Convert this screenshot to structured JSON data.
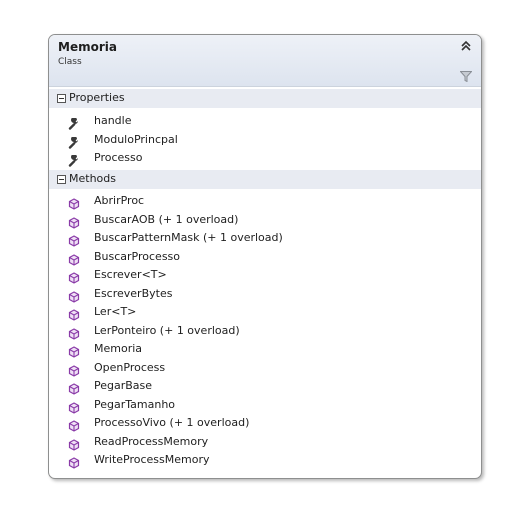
{
  "class_shape": {
    "name": "Memoria",
    "kind": "Class",
    "icons": {
      "collapse": "double-chevron-up-icon",
      "filter": "filter-icon"
    }
  },
  "sections": {
    "properties": {
      "label": "Properties",
      "icon": "wrench-icon",
      "items": [
        "handle",
        "ModuloPrincpal",
        "Processo"
      ]
    },
    "methods": {
      "label": "Methods",
      "icon": "method-cube-icon",
      "items": [
        "AbrirProc",
        "BuscarAOB (+ 1 overload)",
        "BuscarPatternMask (+ 1 overload)",
        "BuscarProcesso",
        "Escrever<T>",
        "EscreverBytes",
        "Ler<T>",
        "LerPonteiro (+ 1 overload)",
        "Memoria",
        "OpenProcess",
        "PegarBase",
        "PegarTamanho",
        "ProcessoVivo (+ 1 overload)",
        "ReadProcessMemory",
        "WriteProcessMemory"
      ]
    }
  },
  "colors": {
    "method_icon": "#8a3ba8",
    "header_bg": "#dde4ef",
    "section_bg": "#e8ebf2",
    "border": "#8e8f8f"
  }
}
